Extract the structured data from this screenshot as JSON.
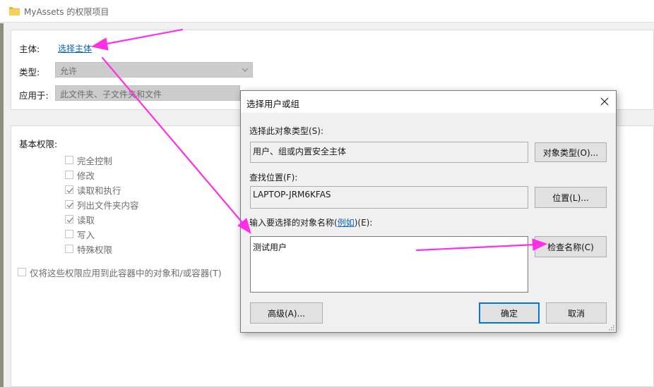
{
  "window": {
    "title": "MyAssets 的权限项目",
    "folder_icon": "folder-icon"
  },
  "principal": {
    "label": "主体:",
    "link": "选择主体"
  },
  "type": {
    "label": "类型:",
    "value": "允许"
  },
  "applies_to": {
    "label": "应用于:",
    "value": "此文件夹、子文件夹和文件"
  },
  "basic_permissions": {
    "label": "基本权限:",
    "items": [
      {
        "label": "完全控制",
        "checked": false
      },
      {
        "label": "修改",
        "checked": false
      },
      {
        "label": "读取和执行",
        "checked": true
      },
      {
        "label": "列出文件夹内容",
        "checked": true
      },
      {
        "label": "读取",
        "checked": true
      },
      {
        "label": "写入",
        "checked": false
      },
      {
        "label": "特殊权限",
        "checked": false
      }
    ],
    "apply_only": "仅将这些权限应用到此容器中的对象和/或容器(T)"
  },
  "dialog": {
    "title": "选择用户或组",
    "object_type_label": "选择此对象类型(S):",
    "object_type_value": "用户、组或内置安全主体",
    "object_type_button": "对象类型(O)...",
    "location_label": "查找位置(F):",
    "location_value": "LAPTOP-JRM6KFAS",
    "location_button": "位置(L)...",
    "enter_names_label": "输入要选择的对象名称(",
    "examples_link": "例如",
    "enter_names_suffix": ")(E):",
    "names_value": "测试用户",
    "check_names_button": "检查名称(C)",
    "advanced_button": "高级(A)...",
    "ok_button": "确定",
    "cancel_button": "取消"
  },
  "colors": {
    "accent": "#0078d7",
    "link": "#0a64c8",
    "annotation_arrow": "#ff2fe8"
  }
}
